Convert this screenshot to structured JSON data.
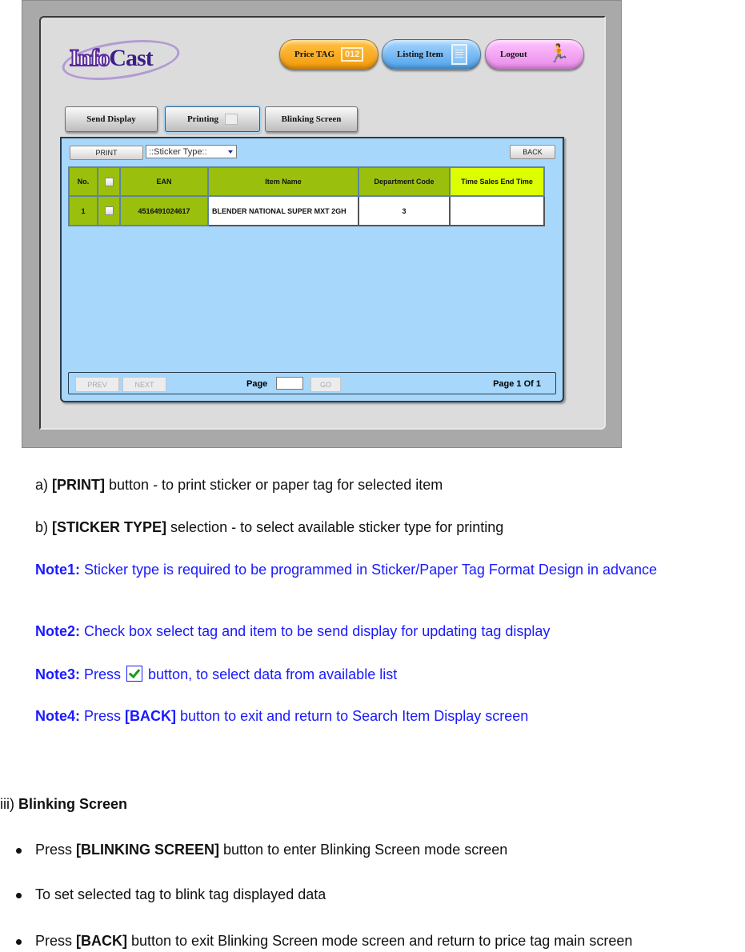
{
  "app": {
    "logo": {
      "part1": "Info",
      "part2": "Cast"
    },
    "top_buttons": {
      "price_tag": {
        "label": "Price TAG",
        "badge": "012"
      },
      "listing_item": {
        "label": "Listing Item"
      },
      "logout": {
        "label": "Logout"
      }
    },
    "tabs": [
      {
        "label": "Send Display",
        "active": false
      },
      {
        "label": "Printing",
        "active": true
      },
      {
        "label": "Blinking Screen",
        "active": false
      }
    ],
    "toolbar": {
      "print_label": "PRINT",
      "sticker_type_selected": "::Sticker Type::",
      "back_label": "BACK"
    },
    "table": {
      "headers": [
        "No.",
        "",
        "EAN",
        "Item Name",
        "Department Code",
        "Time Sales End Time"
      ],
      "rows": [
        {
          "no": "1",
          "checked": false,
          "ean": "4516491024617",
          "item_name": "BLENDER NATIONAL SUPER MXT 2GH",
          "department_code": "3",
          "time_sales_end": ""
        }
      ]
    },
    "pager": {
      "prev_label": "PREV",
      "next_label": "NEXT",
      "page_label": "Page",
      "page_input": "",
      "go_label": "GO",
      "page_info": "Page 1 Of 1"
    },
    "colors": {
      "panel": "#a7d7fb",
      "header_green": "#9bbf0d",
      "header_highlight": "#dcff00",
      "note_blue": "#1a1aff"
    }
  },
  "doc": {
    "a": {
      "prefix": "a) ",
      "bold": "[PRINT]",
      "rest": " button - to print sticker or paper tag for selected item"
    },
    "b": {
      "prefix": "b) ",
      "bold": "[STICKER TYPE]",
      "rest": " selection - to select available sticker type for printing"
    },
    "note1": {
      "label": "Note1:",
      "text": " Sticker type is required to be programmed in Sticker/Paper Tag Format Design in advance"
    },
    "note2": {
      "label": "Note2:",
      "text": " Check  box select tag and item to be send display for updating tag display"
    },
    "note3": {
      "label": "Note3:",
      "before": " Press ",
      "after": " button, to select data from available list"
    },
    "note4": {
      "label": "Note4:",
      "before": " Press ",
      "bold": "[BACK]",
      "after": " button to exit and return to Search Item Display screen"
    },
    "section": {
      "prefix": "iii) ",
      "title": "Blinking Screen"
    },
    "bullets": [
      {
        "before": "Press ",
        "bold": "[BLINKING SCREEN]",
        "after": " button to enter Blinking Screen mode screen"
      },
      {
        "before": "To set selected tag to blink tag displayed data",
        "bold": "",
        "after": ""
      },
      {
        "before": "Press ",
        "bold": "[BACK]",
        "after": " button to exit Blinking Screen mode screen and return to price tag main screen"
      }
    ]
  }
}
